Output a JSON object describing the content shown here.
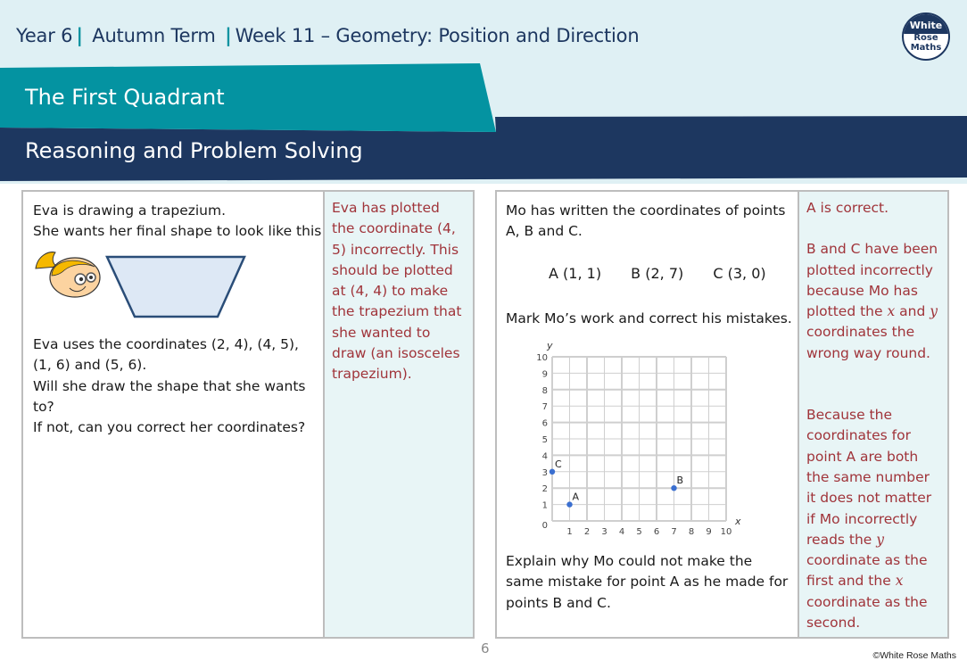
{
  "header": {
    "year": "Year 6",
    "term": "Autumn Term",
    "week": "Week 11 – Geometry: Position and Direction",
    "logo": {
      "line1": "White",
      "line2": "Rose",
      "line3": "Maths"
    }
  },
  "lesson_title": "The First Quadrant",
  "section_title": "Reasoning and Problem Solving",
  "colors": {
    "teal": "#0493a1",
    "navy": "#1d3760",
    "answer_text": "#a0343a",
    "answer_bg": "#e8f5f6",
    "point": "#3a6fd0"
  },
  "question1": {
    "lines": [
      "Eva is drawing a trapezium.",
      "She wants her final shape to look like this:"
    ],
    "character_icon": "girl-face-icon",
    "shape": "trapezium",
    "body": [
      "Eva uses the coordinates (2, 4), (4, 5), (1, 6) and (5, 6).",
      "Will she draw the shape that she wants to?",
      "If not, can you correct her coordinates?"
    ],
    "answer": "Eva has plotted the coordinate (4, 5) incorrectly. This should be plotted at (4, 4) to make the trapezium that she wanted to draw (an isosceles trapezium)."
  },
  "question2": {
    "intro": "Mo has written the coordinates of points A, B and C.",
    "points_written": [
      {
        "label": "A",
        "coords": "(1, 1)"
      },
      {
        "label": "B",
        "coords": "(2, 7)"
      },
      {
        "label": "C",
        "coords": "(3, 0)"
      }
    ],
    "instruction": "Mark Mo’s work and correct his mistakes.",
    "explain": "Explain why Mo could not make the same mistake for point A as he made for points B and C.",
    "answer_parts": [
      "A is correct.",
      "B and C have been plotted incorrectly because Mo has plotted the",
      "x",
      "and",
      "y",
      "coordinates the wrong way round.",
      "Because the coordinates for point A are both the same number it does not matter if Mo incorrectly reads the",
      "y",
      "coordinate as the first and the",
      "x",
      "coordinate as the second."
    ]
  },
  "chart_data": {
    "type": "scatter",
    "title": "",
    "xlabel": "x",
    "ylabel": "y",
    "xlim": [
      0,
      10
    ],
    "ylim": [
      0,
      10
    ],
    "grid": true,
    "x_ticks": [
      "0",
      "1",
      "2",
      "3",
      "4",
      "5",
      "6",
      "7",
      "8",
      "9",
      "10"
    ],
    "y_ticks": [
      "0",
      "1",
      "2",
      "3",
      "4",
      "5",
      "6",
      "7",
      "8",
      "9",
      "10"
    ],
    "points": [
      {
        "label": "A",
        "x": 1,
        "y": 1
      },
      {
        "label": "B",
        "x": 7,
        "y": 2
      },
      {
        "label": "C",
        "x": 0,
        "y": 3
      }
    ]
  },
  "footer": {
    "page_number": "6",
    "copyright": "©White Rose Maths"
  }
}
